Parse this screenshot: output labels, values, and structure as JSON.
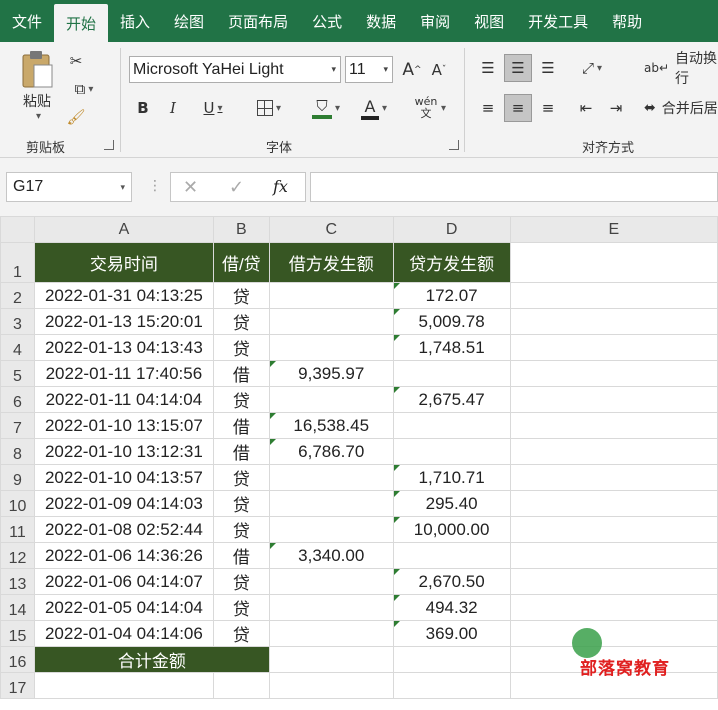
{
  "menu": {
    "items": [
      "文件",
      "开始",
      "插入",
      "绘图",
      "页面布局",
      "公式",
      "数据",
      "审阅",
      "视图",
      "开发工具",
      "帮助"
    ],
    "active": "开始"
  },
  "ribbon": {
    "clipboard": {
      "paste_label": "粘贴",
      "group_label": "剪贴板"
    },
    "font": {
      "font_name": "Microsoft YaHei Light",
      "font_size": "11",
      "bold": "B",
      "italic": "I",
      "underline": "U",
      "grow": "A",
      "shrink": "A",
      "font_color": "A",
      "phonetic": "wén 文",
      "group_label": "字体"
    },
    "alignment": {
      "wrap_label": "自动换行",
      "merge_label": "合并后居",
      "group_label": "对齐方式"
    }
  },
  "formula_bar": {
    "name_box": "G17",
    "fx": "fx",
    "cancel": "✕",
    "confirm": "✓",
    "formula": ""
  },
  "sheet": {
    "columns": [
      "A",
      "B",
      "C",
      "D",
      "E"
    ],
    "header_row": [
      "交易时间",
      "借/贷",
      "借方发生额",
      "贷方发生额"
    ],
    "rows": [
      {
        "row": "2",
        "time": "2022-01-31 04:13:25",
        "type": "贷",
        "debit": "",
        "credit": "172.07"
      },
      {
        "row": "3",
        "time": "2022-01-13 15:20:01",
        "type": "贷",
        "debit": "",
        "credit": "5,009.78"
      },
      {
        "row": "4",
        "time": "2022-01-13 04:13:43",
        "type": "贷",
        "debit": "",
        "credit": "1,748.51"
      },
      {
        "row": "5",
        "time": "2022-01-11 17:40:56",
        "type": "借",
        "debit": "9,395.97",
        "credit": ""
      },
      {
        "row": "6",
        "time": "2022-01-11 04:14:04",
        "type": "贷",
        "debit": "",
        "credit": "2,675.47"
      },
      {
        "row": "7",
        "time": "2022-01-10 13:15:07",
        "type": "借",
        "debit": "16,538.45",
        "credit": ""
      },
      {
        "row": "8",
        "time": "2022-01-10 13:12:31",
        "type": "借",
        "debit": "6,786.70",
        "credit": ""
      },
      {
        "row": "9",
        "time": "2022-01-10 04:13:57",
        "type": "贷",
        "debit": "",
        "credit": "1,710.71"
      },
      {
        "row": "10",
        "time": "2022-01-09 04:14:03",
        "type": "贷",
        "debit": "",
        "credit": "295.40"
      },
      {
        "row": "11",
        "time": "2022-01-08 02:52:44",
        "type": "贷",
        "debit": "",
        "credit": "10,000.00"
      },
      {
        "row": "12",
        "time": "2022-01-06 14:36:26",
        "type": "借",
        "debit": "3,340.00",
        "credit": ""
      },
      {
        "row": "13",
        "time": "2022-01-06 04:14:07",
        "type": "贷",
        "debit": "",
        "credit": "2,670.50"
      },
      {
        "row": "14",
        "time": "2022-01-05 04:14:04",
        "type": "贷",
        "debit": "",
        "credit": "494.32"
      },
      {
        "row": "15",
        "time": "2022-01-04 04:14:06",
        "type": "贷",
        "debit": "",
        "credit": "369.00"
      }
    ],
    "total_label": "合计金额",
    "header_color": "#375623"
  },
  "watermark": "部落窝教育"
}
